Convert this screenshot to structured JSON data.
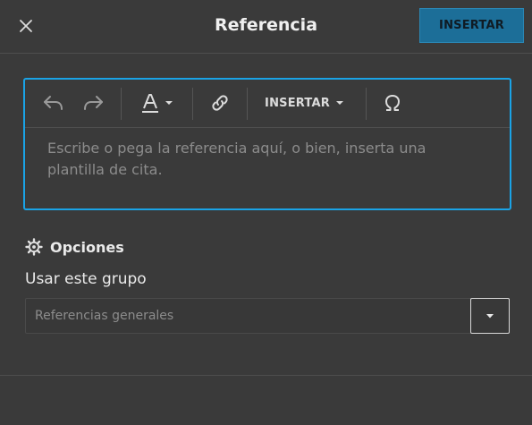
{
  "header": {
    "title": "Referencia",
    "insert_button": "INSERTAR"
  },
  "toolbar": {
    "items": [
      {
        "icon": "undo-icon"
      },
      {
        "icon": "redo-icon"
      },
      {
        "icon": "text-style-icon"
      },
      {
        "icon": "link-icon"
      },
      {
        "label": "INSERTAR",
        "icon": "chevron-down-icon"
      },
      {
        "icon": "omega-icon"
      }
    ]
  },
  "editor": {
    "placeholder": "Escribe o pega la referencia aquí, o bien, inserta una plantilla de cita."
  },
  "options": {
    "title": "Opciones",
    "group_label": "Usar este grupo",
    "group_select": {
      "placeholder": "Referencias generales"
    }
  },
  "colors": {
    "background": "#3a3a3a",
    "accent": "#1aa3e6",
    "insert_button_bg": "#1c6e98"
  }
}
